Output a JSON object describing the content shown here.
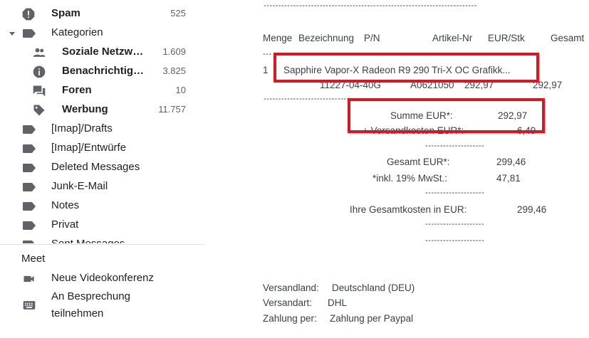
{
  "sidebar": {
    "spam": {
      "label": "Spam",
      "count": "525"
    },
    "kategorien": {
      "label": "Kategorien"
    },
    "categories": [
      {
        "label": "Soziale Netzw…",
        "count": "1.609"
      },
      {
        "label": "Benachrichtig…",
        "count": "3.825"
      },
      {
        "label": "Foren",
        "count": "10"
      },
      {
        "label": "Werbung",
        "count": "11.757"
      }
    ],
    "labels": [
      "[Imap]/Drafts",
      "[Imap]/Entwürfe",
      "Deleted Messages",
      "Junk-E-Mail",
      "Notes",
      "Privat",
      "Sent Messages"
    ]
  },
  "meet": {
    "title": "Meet",
    "new_meeting": "Neue Videokonferenz",
    "join_line1": "An Besprechung",
    "join_line2": "teilnehmen"
  },
  "email": {
    "dash_top": "------------------------------------------------------------------------",
    "headers": {
      "menge": "Menge",
      "bezeichnung": "Bezeichnung",
      "pn": "P/N",
      "artikel": "Artikel-Nr",
      "eur": "EUR/Stk",
      "gesamt": "Gesamt"
    },
    "dash_short": "---",
    "item": {
      "qty": "1",
      "name": "Sapphire Vapor-X Radeon R9 290 Tri-X OC Grafikk...",
      "pn": "11227-04-40G",
      "artikel": "A0621050",
      "price": "292,97",
      "total": "292,97"
    },
    "dash_mid": "------------------------------------------------------------------------",
    "summe_label": "Summe EUR*:",
    "summe_value": "292,97",
    "versand_label": "+ Versandkosten EUR*:",
    "versand_value": "6,49",
    "dash_sum": "--------------------",
    "gesamt_label": "Gesamt EUR*:",
    "gesamt_value": "299,46",
    "mwst_label": "*inkl. 19% MwSt.:",
    "mwst_value": "47,81",
    "dash_sum2": "--------------------",
    "ihre_label": "Ihre Gesamtkosten in EUR:",
    "ihre_value": "299,46",
    "dash_sum3": "--------------------",
    "dash_sum4": "--------------------",
    "versandland_label": "Versandland:",
    "versandland_value": "Deutschland (DEU)",
    "versandart_label": "Versandart:",
    "versandart_value": "DHL",
    "zahlung_label": "Zahlung per:",
    "zahlung_value": "Zahlung per Paypal"
  },
  "colors": {
    "highlight": "#e0141e",
    "icon": "#5f6368"
  }
}
